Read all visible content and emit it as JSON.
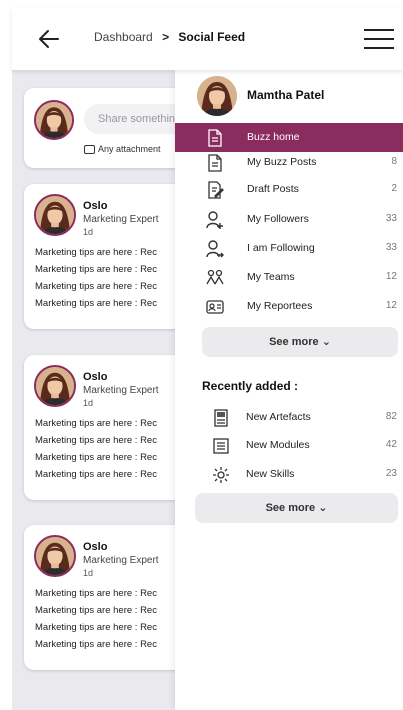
{
  "header": {
    "breadcrumb_parent": "Dashboard",
    "breadcrumb_separator": ">",
    "breadcrumb_current": "Social Feed"
  },
  "composer": {
    "placeholder": "Share somethin",
    "attachment_label": "Any attachment"
  },
  "posts": [
    {
      "name": "Oslo",
      "role": "Marketing Expert",
      "time": "1d",
      "lines": [
        "Marketing tips are here : Rec",
        "Marketing tips are here : Rec",
        "Marketing tips are here : Rec",
        "Marketing tips are here : Rec"
      ]
    },
    {
      "name": "Oslo",
      "role": "Marketing Expert",
      "time": "1d",
      "lines": [
        "Marketing tips are here : Rec",
        "Marketing tips are here : Rec",
        "Marketing tips are here : Rec",
        "Marketing tips are here : Rec"
      ]
    },
    {
      "name": "Oslo",
      "role": "Marketing Expert",
      "time": "1d",
      "lines": [
        "Marketing tips are here : Rec",
        "Marketing tips are here : Rec",
        "Marketing tips are here : Rec",
        "Marketing tips are here : Rec"
      ]
    }
  ],
  "drawer": {
    "user_name": "Mamtha Patel",
    "menu": [
      {
        "label": "Buzz home",
        "count": "",
        "icon": "document-icon"
      },
      {
        "label": "My Buzz Posts",
        "count": "8",
        "icon": "document-icon"
      },
      {
        "label": "Draft Posts",
        "count": "2",
        "icon": "draft-edit-icon"
      },
      {
        "label": "My Followers",
        "count": "33",
        "icon": "user-add-icon"
      },
      {
        "label": "I am Following",
        "count": "33",
        "icon": "user-follow-icon"
      },
      {
        "label": "My Teams",
        "count": "12",
        "icon": "team-icon"
      },
      {
        "label": "My Reportees",
        "count": "12",
        "icon": "id-card-icon"
      }
    ],
    "see_more": "See more",
    "recent_title": "Recently added :",
    "recent": [
      {
        "label": "New Artefacts",
        "count": "82",
        "icon": "artefact-icon"
      },
      {
        "label": "New Modules",
        "count": "42",
        "icon": "module-icon"
      },
      {
        "label": "New Skills",
        "count": "23",
        "icon": "skill-gear-icon"
      }
    ],
    "see_more_2": "See more"
  },
  "colors": {
    "accent": "#8b2c5f",
    "backdrop": "#e9e9ee",
    "chip": "#ebebee"
  }
}
